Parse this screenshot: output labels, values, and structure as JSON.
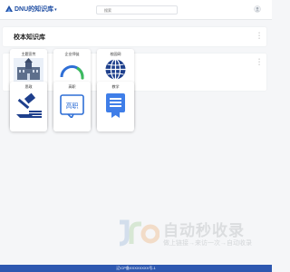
{
  "header": {
    "brand": "DNU的知识库",
    "caret": "▾",
    "search_placeholder": "搜索"
  },
  "sections": [
    {
      "title": "校本知识库"
    },
    {
      "title": ""
    }
  ],
  "cards": [
    {
      "label": "主题宣传",
      "icon": "building-icon"
    },
    {
      "label": "企业师徒",
      "icon": "gauge-icon"
    },
    {
      "label": "校园网",
      "icon": "globe-icon"
    },
    {
      "label": "思政",
      "icon": "gavel-icon"
    },
    {
      "label": "高职",
      "icon": "chat-bubble-icon"
    },
    {
      "label": "教学",
      "icon": "document-badge-icon"
    }
  ],
  "watermark": {
    "title": "自动秒收录",
    "subtitle": "做上链接→来访一次→自动收录"
  },
  "footer": {
    "text": "辽ICP备XXXXXXXX号-1"
  },
  "colors": {
    "brand": "#1f4ea3",
    "footer_bg": "#2e58b0",
    "accent_blue": "#2f6fd6",
    "gauge_green": "#3dbb5c"
  }
}
